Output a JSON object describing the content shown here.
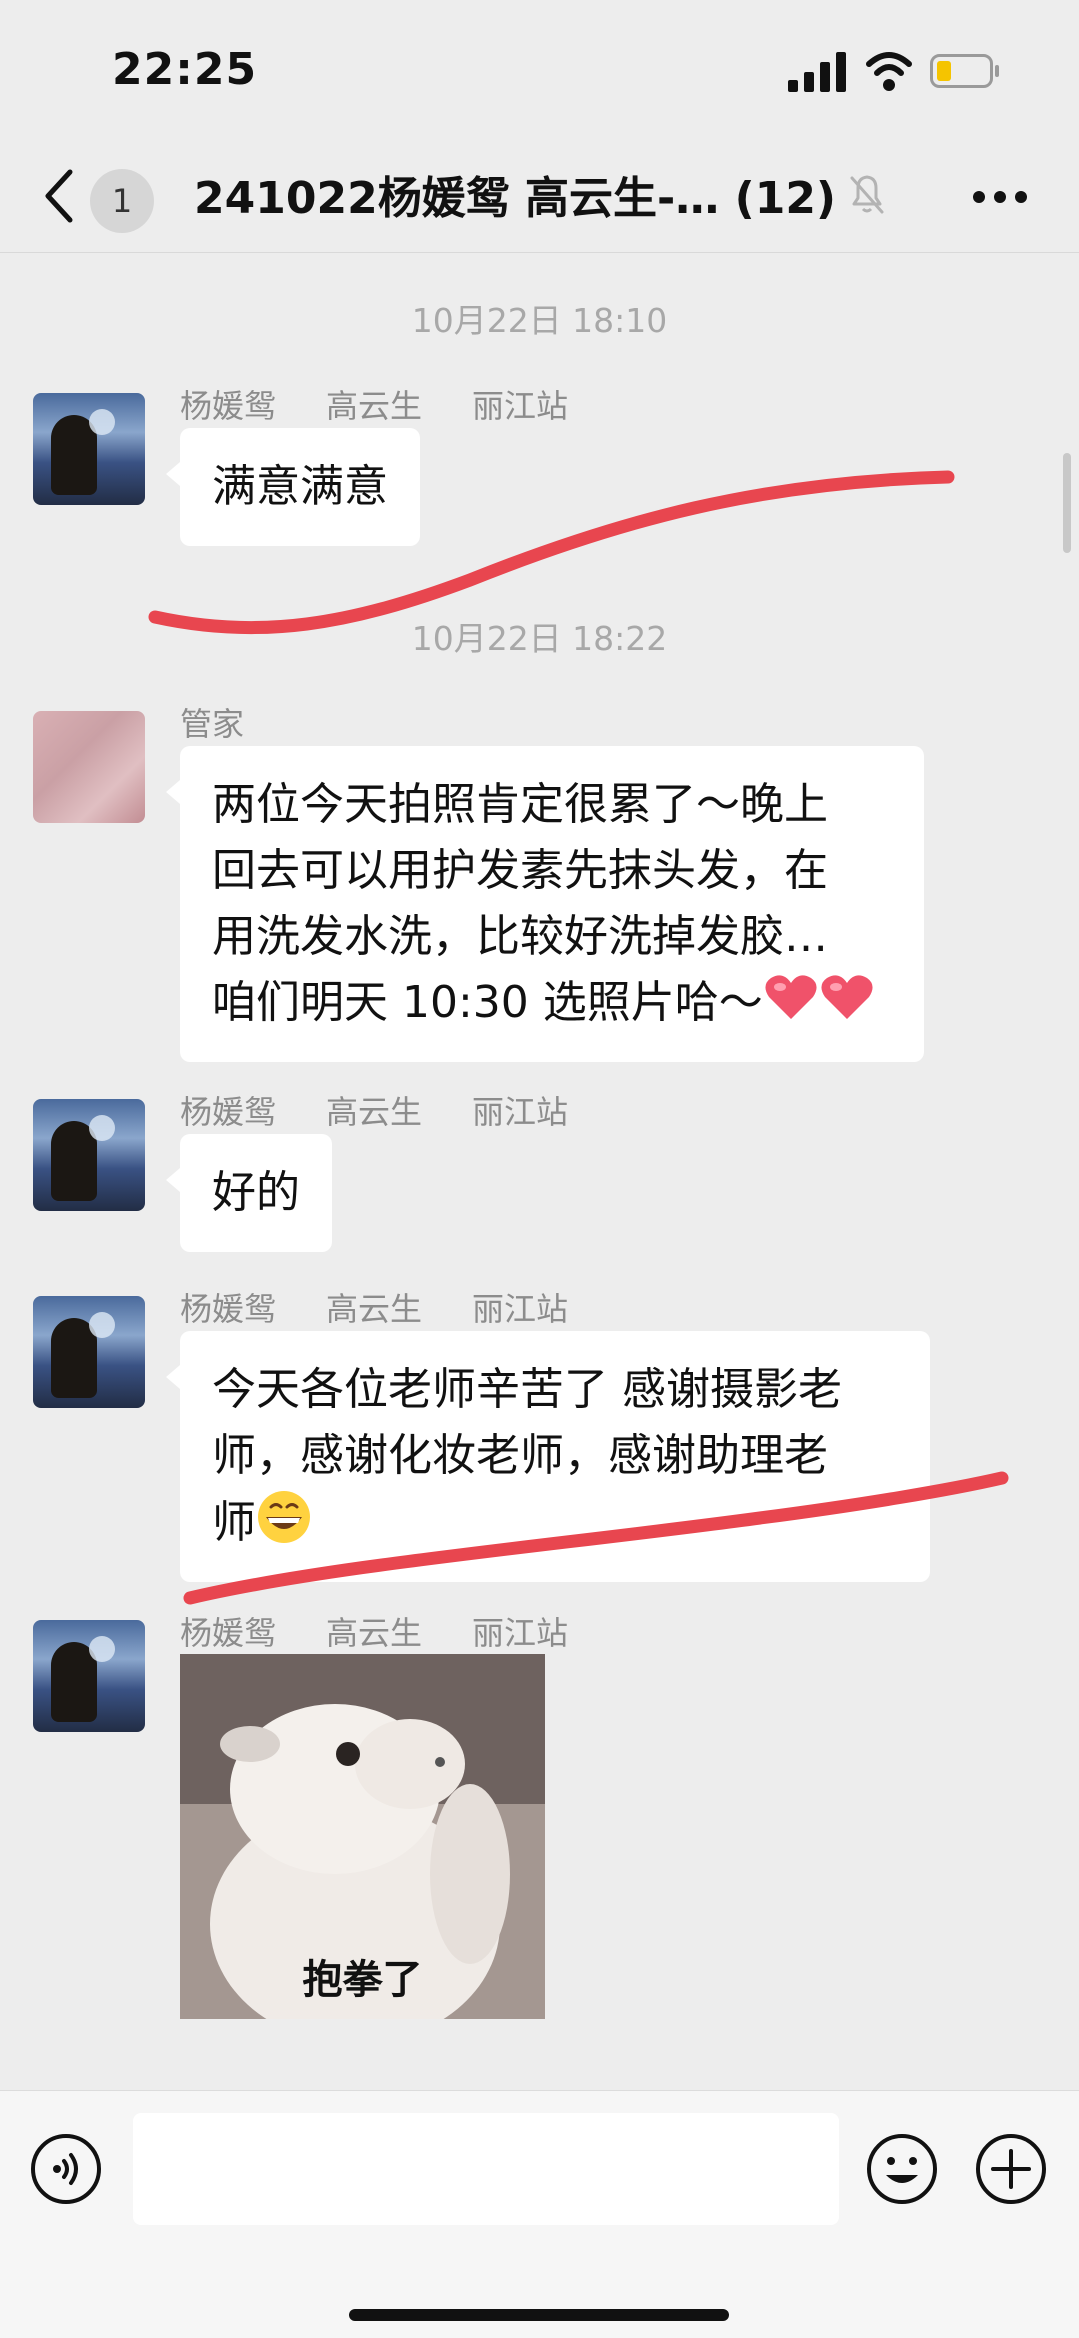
{
  "status_bar": {
    "time": "22:25"
  },
  "header": {
    "unread_count": "1",
    "title": "241022杨媛鸳  高云生-…  (12)"
  },
  "messages": [
    {
      "type": "time",
      "text": "10月22日 18:10"
    },
    {
      "type": "text",
      "sender_parts": [
        "杨媛鸳",
        "高云生",
        "丽江站"
      ],
      "text": "满意满意"
    },
    {
      "type": "time",
      "text": "10月22日 18:22"
    },
    {
      "type": "text",
      "sender_parts": [
        "管家"
      ],
      "lines": [
        "两位今天拍照肯定很累了～晚上",
        "回去可以用护发素先抹头发，在",
        "用洗发水洗，比较好洗掉发胶…",
        "咱们明天 10:30 选照片哈～"
      ],
      "trailing_emoji": [
        "red-heart",
        "red-heart"
      ]
    },
    {
      "type": "text",
      "sender_parts": [
        "杨媛鸳",
        "高云生",
        "丽江站"
      ],
      "text": "好的"
    },
    {
      "type": "text",
      "sender_parts": [
        "杨媛鸳",
        "高云生",
        "丽江站"
      ],
      "lines": [
        "今天各位老师辛苦了 感谢摄影老",
        "师，感谢化妆老师，感谢助理老",
        "师"
      ],
      "trailing_emoji": [
        "grinning-face"
      ]
    },
    {
      "type": "sticker",
      "sender_parts": [
        "杨媛鸳",
        "高云生",
        "丽江站"
      ],
      "caption": "抱拳了"
    }
  ],
  "input_bar": {
    "placeholder": "",
    "icons": [
      "voice-icon",
      "emoji-icon",
      "plus-icon"
    ]
  },
  "colors": {
    "background": "#ededed",
    "bubble": "#ffffff",
    "annotation_stroke": "#e8464f",
    "meta_text": "#8c8c8c"
  }
}
